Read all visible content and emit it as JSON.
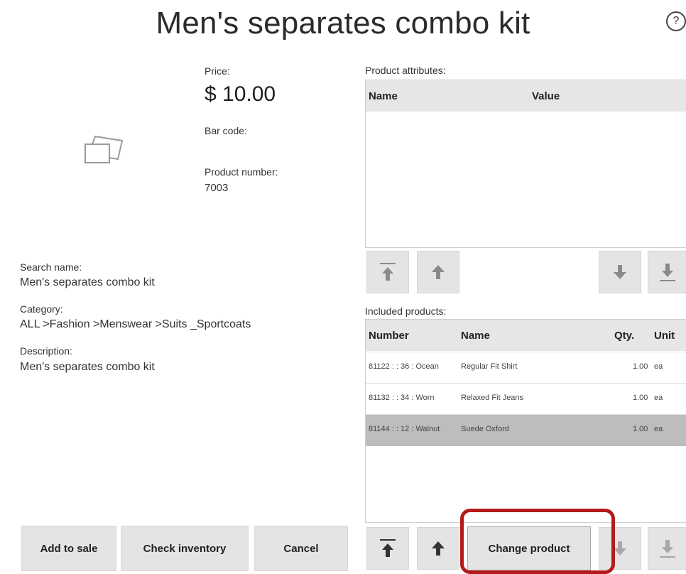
{
  "header": {
    "title": "Men's separates combo kit",
    "help_icon": "?"
  },
  "product": {
    "price_label": "Price:",
    "price_value": "$ 10.00",
    "barcode_label": "Bar code:",
    "number_label": "Product number:",
    "number_value": "7003",
    "search_name_label": "Search name:",
    "search_name_value": "Men's separates combo kit",
    "category_label": "Category:",
    "category_value": "ALL >Fashion >Menswear >Suits _Sportcoats",
    "description_label": "Description:",
    "description_value": "Men's separates combo kit"
  },
  "attributes": {
    "label": "Product attributes:",
    "columns": [
      "Name",
      "Value"
    ]
  },
  "included": {
    "label": "Included products:",
    "columns": [
      "Number",
      "Name",
      "Qty.",
      "Unit"
    ],
    "rows": [
      [
        "81122 : : 36 : Ocean",
        "Regular Fit Shirt",
        "1.00",
        "ea"
      ],
      [
        "81132 : : 34 : Worn",
        "Relaxed Fit Jeans",
        "1.00",
        "ea"
      ],
      [
        "81144 : : 12 : Walnut",
        "Suede Oxford",
        "1.00",
        "ea"
      ]
    ]
  },
  "actions": {
    "add_to_sale": "Add to sale",
    "check_inventory": "Check inventory",
    "cancel": "Cancel",
    "change_product": "Change product"
  },
  "colors": {
    "highlight": "#b31b1b",
    "button_bg": "#e4e4e4",
    "selected_row": "#bdbdbd"
  }
}
